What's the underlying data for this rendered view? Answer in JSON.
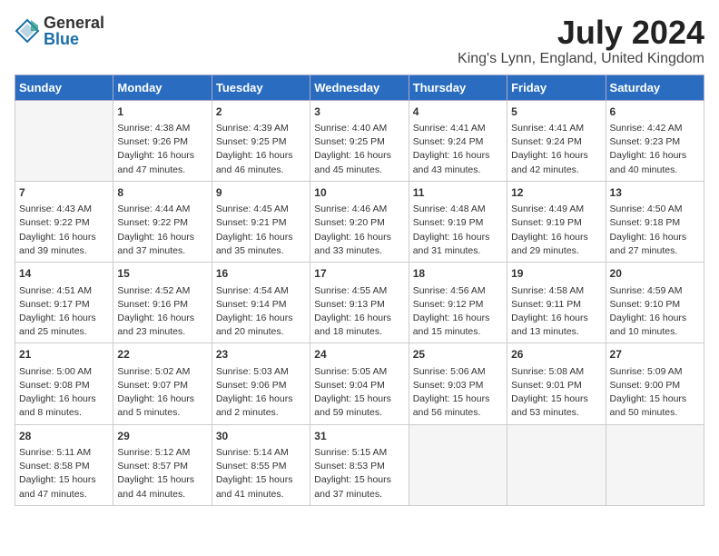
{
  "header": {
    "logo_general": "General",
    "logo_blue": "Blue",
    "month_title": "July 2024",
    "location": "King's Lynn, England, United Kingdom"
  },
  "days_of_week": [
    "Sunday",
    "Monday",
    "Tuesday",
    "Wednesday",
    "Thursday",
    "Friday",
    "Saturday"
  ],
  "weeks": [
    [
      {
        "num": "",
        "info": ""
      },
      {
        "num": "1",
        "info": "Sunrise: 4:38 AM\nSunset: 9:26 PM\nDaylight: 16 hours\nand 47 minutes."
      },
      {
        "num": "2",
        "info": "Sunrise: 4:39 AM\nSunset: 9:25 PM\nDaylight: 16 hours\nand 46 minutes."
      },
      {
        "num": "3",
        "info": "Sunrise: 4:40 AM\nSunset: 9:25 PM\nDaylight: 16 hours\nand 45 minutes."
      },
      {
        "num": "4",
        "info": "Sunrise: 4:41 AM\nSunset: 9:24 PM\nDaylight: 16 hours\nand 43 minutes."
      },
      {
        "num": "5",
        "info": "Sunrise: 4:41 AM\nSunset: 9:24 PM\nDaylight: 16 hours\nand 42 minutes."
      },
      {
        "num": "6",
        "info": "Sunrise: 4:42 AM\nSunset: 9:23 PM\nDaylight: 16 hours\nand 40 minutes."
      }
    ],
    [
      {
        "num": "7",
        "info": "Sunrise: 4:43 AM\nSunset: 9:22 PM\nDaylight: 16 hours\nand 39 minutes."
      },
      {
        "num": "8",
        "info": "Sunrise: 4:44 AM\nSunset: 9:22 PM\nDaylight: 16 hours\nand 37 minutes."
      },
      {
        "num": "9",
        "info": "Sunrise: 4:45 AM\nSunset: 9:21 PM\nDaylight: 16 hours\nand 35 minutes."
      },
      {
        "num": "10",
        "info": "Sunrise: 4:46 AM\nSunset: 9:20 PM\nDaylight: 16 hours\nand 33 minutes."
      },
      {
        "num": "11",
        "info": "Sunrise: 4:48 AM\nSunset: 9:19 PM\nDaylight: 16 hours\nand 31 minutes."
      },
      {
        "num": "12",
        "info": "Sunrise: 4:49 AM\nSunset: 9:19 PM\nDaylight: 16 hours\nand 29 minutes."
      },
      {
        "num": "13",
        "info": "Sunrise: 4:50 AM\nSunset: 9:18 PM\nDaylight: 16 hours\nand 27 minutes."
      }
    ],
    [
      {
        "num": "14",
        "info": "Sunrise: 4:51 AM\nSunset: 9:17 PM\nDaylight: 16 hours\nand 25 minutes."
      },
      {
        "num": "15",
        "info": "Sunrise: 4:52 AM\nSunset: 9:16 PM\nDaylight: 16 hours\nand 23 minutes."
      },
      {
        "num": "16",
        "info": "Sunrise: 4:54 AM\nSunset: 9:14 PM\nDaylight: 16 hours\nand 20 minutes."
      },
      {
        "num": "17",
        "info": "Sunrise: 4:55 AM\nSunset: 9:13 PM\nDaylight: 16 hours\nand 18 minutes."
      },
      {
        "num": "18",
        "info": "Sunrise: 4:56 AM\nSunset: 9:12 PM\nDaylight: 16 hours\nand 15 minutes."
      },
      {
        "num": "19",
        "info": "Sunrise: 4:58 AM\nSunset: 9:11 PM\nDaylight: 16 hours\nand 13 minutes."
      },
      {
        "num": "20",
        "info": "Sunrise: 4:59 AM\nSunset: 9:10 PM\nDaylight: 16 hours\nand 10 minutes."
      }
    ],
    [
      {
        "num": "21",
        "info": "Sunrise: 5:00 AM\nSunset: 9:08 PM\nDaylight: 16 hours\nand 8 minutes."
      },
      {
        "num": "22",
        "info": "Sunrise: 5:02 AM\nSunset: 9:07 PM\nDaylight: 16 hours\nand 5 minutes."
      },
      {
        "num": "23",
        "info": "Sunrise: 5:03 AM\nSunset: 9:06 PM\nDaylight: 16 hours\nand 2 minutes."
      },
      {
        "num": "24",
        "info": "Sunrise: 5:05 AM\nSunset: 9:04 PM\nDaylight: 15 hours\nand 59 minutes."
      },
      {
        "num": "25",
        "info": "Sunrise: 5:06 AM\nSunset: 9:03 PM\nDaylight: 15 hours\nand 56 minutes."
      },
      {
        "num": "26",
        "info": "Sunrise: 5:08 AM\nSunset: 9:01 PM\nDaylight: 15 hours\nand 53 minutes."
      },
      {
        "num": "27",
        "info": "Sunrise: 5:09 AM\nSunset: 9:00 PM\nDaylight: 15 hours\nand 50 minutes."
      }
    ],
    [
      {
        "num": "28",
        "info": "Sunrise: 5:11 AM\nSunset: 8:58 PM\nDaylight: 15 hours\nand 47 minutes."
      },
      {
        "num": "29",
        "info": "Sunrise: 5:12 AM\nSunset: 8:57 PM\nDaylight: 15 hours\nand 44 minutes."
      },
      {
        "num": "30",
        "info": "Sunrise: 5:14 AM\nSunset: 8:55 PM\nDaylight: 15 hours\nand 41 minutes."
      },
      {
        "num": "31",
        "info": "Sunrise: 5:15 AM\nSunset: 8:53 PM\nDaylight: 15 hours\nand 37 minutes."
      },
      {
        "num": "",
        "info": ""
      },
      {
        "num": "",
        "info": ""
      },
      {
        "num": "",
        "info": ""
      }
    ]
  ]
}
